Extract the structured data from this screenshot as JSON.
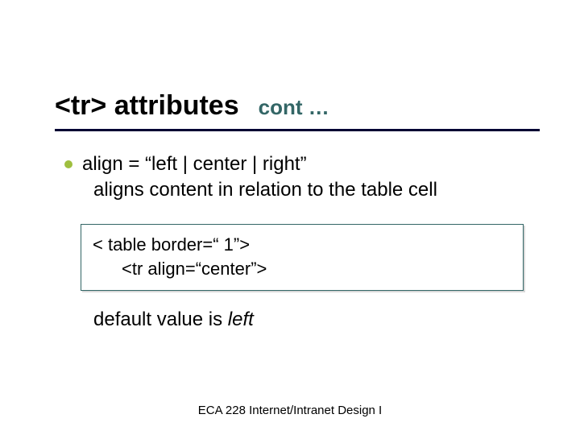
{
  "title": {
    "main": "<tr> attributes",
    "sub": "cont …"
  },
  "body": {
    "bullet": "align = “left | center | right”",
    "bullet_sub": "aligns content in relation to the table cell",
    "code_line1": "< table border=“ 1”>",
    "code_line2": "<tr align=“center”>",
    "default_text": "default value is ",
    "default_value": "left"
  },
  "footer": "ECA 228  Internet/Intranet Design I"
}
